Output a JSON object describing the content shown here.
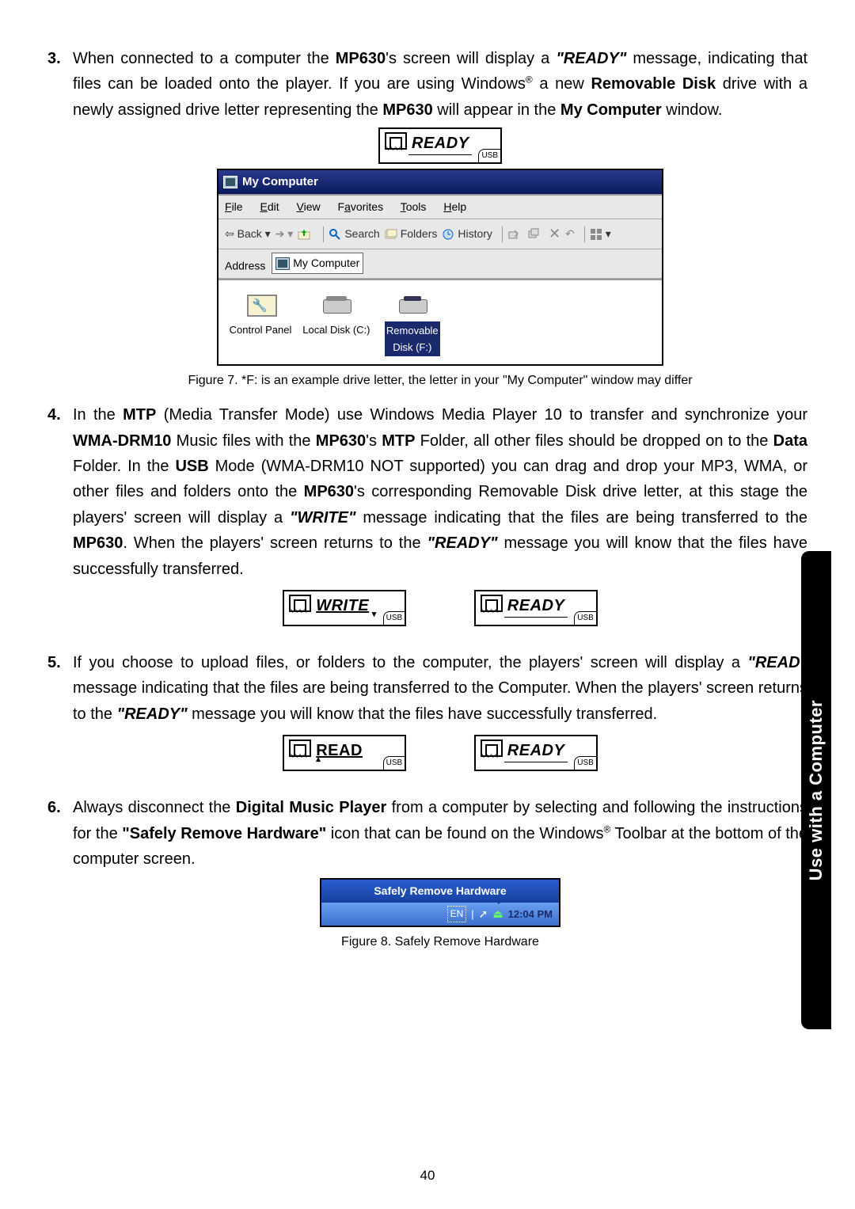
{
  "side_tab": "Use with a Computer",
  "page_number": "40",
  "items": {
    "i3": {
      "num": "3.",
      "t1": "When connected to a computer the ",
      "mp630a": "MP630",
      "t2": "'s screen will display a ",
      "ready_q": "\"READY\"",
      "t3": " message, indicating that files can be loaded onto the player. If you are using Windows",
      "reg1": "®",
      "t4": " a new ",
      "remdisk": "Removable Disk",
      "t5": " drive with a newly assigned drive letter representing the ",
      "mp630b": "MP630",
      "t6": " will appear in the ",
      "mycomp": "My Computer",
      "t7": " window."
    },
    "i4": {
      "num": "4.",
      "t1": "In the ",
      "mtp1": "MTP",
      "t2": " (Media Transfer Mode) use Windows Media Player 10 to transfer and synchronize your ",
      "wma": "WMA-DRM10",
      "t3": " Music files with the ",
      "mp630a": "MP630",
      "t4": "'s ",
      "mtp2": "MTP",
      "t5": " Folder, all other files should be dropped on to the ",
      "data": "Data",
      "t6": " Folder. In the ",
      "usb": "USB",
      "t7": " Mode (WMA-DRM10 NOT supported) you can drag and drop your MP3, WMA, or other files and folders onto the ",
      "mp630b": "MP630",
      "t8": "'s corresponding Removable Disk drive letter, at this stage the players' screen will display a ",
      "write_q": "\"WRITE\"",
      "t9": " message indicating that the files are being transferred to the ",
      "mp630c": "MP630",
      "t10": ". When the players' screen returns to the ",
      "ready_q": "\"READY\"",
      "t11": " message you will know that the files have successfully transferred."
    },
    "i5": {
      "num": "5.",
      "t1": "If you choose to upload files, or folders to the computer, the players' screen will display a ",
      "read_q": "\"READ\"",
      "t2": " message indicating that the files are being transferred to the Computer. When the players' screen returns to the ",
      "ready_q": "\"READY\"",
      "t3": " message you will know that the files have successfully transferred."
    },
    "i6": {
      "num": "6.",
      "t1": "Always disconnect the ",
      "dmp": "Digital Music Player",
      "t2": " from a computer by selecting and following the instructions for the ",
      "srh_q": "\"Safely Remove Hardware\"",
      "t3": " icon that can be found on the Windows",
      "reg": "®",
      "t4": " Toolbar at the bottom of the computer screen."
    }
  },
  "lcd": {
    "ready": "READY",
    "write": "WRITE",
    "read": "READ",
    "usb": "USB"
  },
  "fig7_caption": "Figure 7. *F: is an example drive letter, the letter in your \"My Computer\" window may differ",
  "fig8_caption": "Figure 8. Safely Remove Hardware",
  "mycomp": {
    "title": "My Computer",
    "menu": {
      "file": "File",
      "edit": "Edit",
      "view": "View",
      "fav": "Favorites",
      "tools": "Tools",
      "help": "Help"
    },
    "toolbar": {
      "back": "Back",
      "search": "Search",
      "folders": "Folders",
      "history": "History"
    },
    "address_label": "Address",
    "address_value": "My Computer",
    "items": {
      "cp": "Control Panel",
      "local": "Local Disk (C:)",
      "removable_l1": "Removable",
      "removable_l2": "Disk (F:)"
    }
  },
  "srh": {
    "balloon": "Safely Remove Hardware",
    "lang": "EN",
    "time": "12:04 PM"
  }
}
